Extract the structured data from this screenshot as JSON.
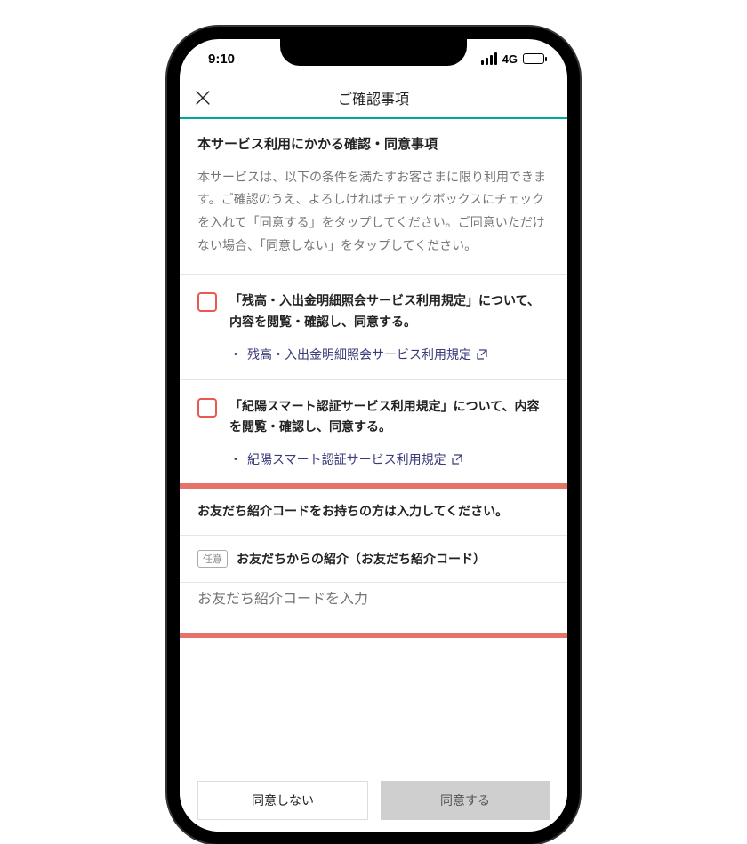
{
  "status": {
    "time": "9:10",
    "network": "4G"
  },
  "nav": {
    "title": "ご確認事項"
  },
  "intro": {
    "heading": "本サービス利用にかかる確認・同意事項",
    "body": "本サービスは、以下の条件を満たすお客さまに限り利用できます。ご確認のうえ、よろしければチェックボックスにチェックを入れて「同意する」をタップしてください。ご同意いただけない場合、「同意しない」をタップしてください。"
  },
  "agree1": {
    "text": "「残高・入出金明細照会サービス利用規定」について、内容を閲覧・確認し、同意する。",
    "linkText": "残高・入出金明細照会サービス利用規定"
  },
  "agree2": {
    "text": "「紀陽スマート認証サービス利用規定」について、内容を閲覧・確認し、同意する。",
    "linkText": "紀陽スマート認証サービス利用規定"
  },
  "referral": {
    "heading": "お友だち紹介コードをお持ちの方は入力してください。",
    "badge": "任意",
    "label": "お友だちからの紹介（お友だち紹介コード）",
    "placeholder": "お友だち紹介コードを入力"
  },
  "footer": {
    "disagree": "同意しない",
    "agree": "同意する"
  }
}
